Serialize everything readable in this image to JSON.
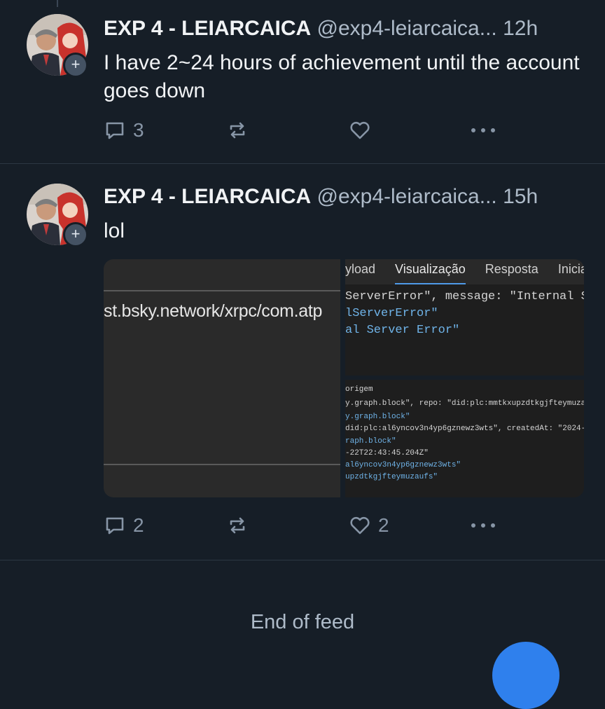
{
  "posts": [
    {
      "display_name": "EXP 4 - LEIARCAICA",
      "handle": "@exp4-leiarcaica...",
      "time": "12h",
      "text": "I have 2~24 hours of achievement until the account goes down",
      "replies": "3",
      "likes": ""
    },
    {
      "display_name": "EXP 4 - LEIARCAICA",
      "handle": "@exp4-leiarcaica...",
      "time": "15h",
      "text": "lol",
      "replies": "2",
      "likes": "2",
      "media": {
        "left_url": "st.bsky.network/xrpc/com.atp",
        "tabs": [
          "yload",
          "Visualização",
          "Resposta",
          "Inicia"
        ],
        "right_top_lines": [
          "ServerError\", message: \"Internal Se",
          "lServerError\"",
          "al Server Error\""
        ],
        "right_bottom_lines": [
          "origem",
          "y.graph.block\", repo: \"did:plc:mmtkxupzdtkgjfteymuzau",
          "y.graph.block\"",
          "did:plc:al6yncov3n4yp6gznewz3wts\", createdAt: \"2024-1",
          "raph.block\"",
          "-22T22:43:45.204Z\"",
          "al6yncov3n4yp6gznewz3wts\"",
          "upzdtkgjfteymuzaufs\""
        ]
      }
    }
  ],
  "feed_end_text": "End of feed",
  "icons": {
    "reply": "speech-bubble-icon",
    "repost": "repost-icon",
    "like": "heart-icon",
    "more": "more-dots-icon",
    "follow": "plus-icon"
  },
  "colors": {
    "accent": "#2f80ed",
    "background": "#161e27"
  }
}
